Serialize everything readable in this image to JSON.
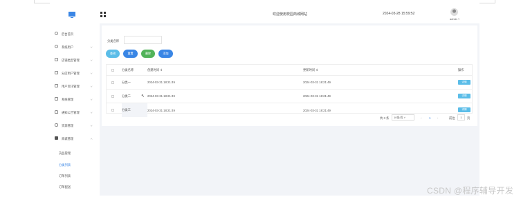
{
  "header": {
    "site_title": "欢迎使用校园商城网站",
    "datetime": "2024-03-28 15:59:52",
    "username": "admin ˅"
  },
  "sidebar": {
    "items": [
      {
        "label": "后台首页",
        "icon": "clock-icon"
      },
      {
        "label": "系统用户",
        "icon": "user-icon"
      },
      {
        "label": "店铺类型管理",
        "icon": "list-icon"
      },
      {
        "label": "分店用户管理",
        "icon": "list-icon"
      },
      {
        "label": "用户资讯管理",
        "icon": "list-icon"
      },
      {
        "label": "系统管理",
        "icon": "list-icon"
      },
      {
        "label": "通知公告管理",
        "icon": "bell-icon"
      },
      {
        "label": "资源管理",
        "icon": "db-icon"
      },
      {
        "label": "商城管理",
        "icon": "shop-icon"
      }
    ],
    "sub_items": [
      {
        "label": "货品管理"
      },
      {
        "label": "分类列表"
      },
      {
        "label": "订单列表"
      },
      {
        "label": "订单配送"
      }
    ]
  },
  "search": {
    "label": "分类名称",
    "value": "",
    "placeholder": ""
  },
  "actions": {
    "query": "查询",
    "reset": "重置",
    "delete": "删除",
    "add": "添加"
  },
  "table": {
    "headers": [
      "分类名称",
      "创建时间 ⇕",
      "更新时间 ⇕",
      "操作"
    ],
    "rows": [
      {
        "name": "分类一",
        "created": "2024-03-31 18:21:49",
        "updated": "2024-03-31 18:21:49",
        "action": "详情"
      },
      {
        "name": "分类二",
        "created": "2024-03-31 18:21:49",
        "updated": "2024-03-31 18:21:49",
        "action": "详情"
      },
      {
        "name": "分类三",
        "created": "2024-03-31 18:21:49",
        "updated": "2024-03-31 18:21:49",
        "action": "详情"
      }
    ]
  },
  "pagination": {
    "total": "共 3 条",
    "page_size": "10条/页 ˅",
    "prev": "‹",
    "current": "1",
    "next": "›",
    "goto_label": "前往",
    "goto_value": "1",
    "goto_suffix": "页"
  },
  "watermark": "CSDN @程序辅导开发",
  "colors": {
    "accent": "#3a86e5",
    "query": "#5bbde8",
    "reset": "#3a86e5",
    "delete": "#52b35a",
    "add": "#3a86e5"
  }
}
